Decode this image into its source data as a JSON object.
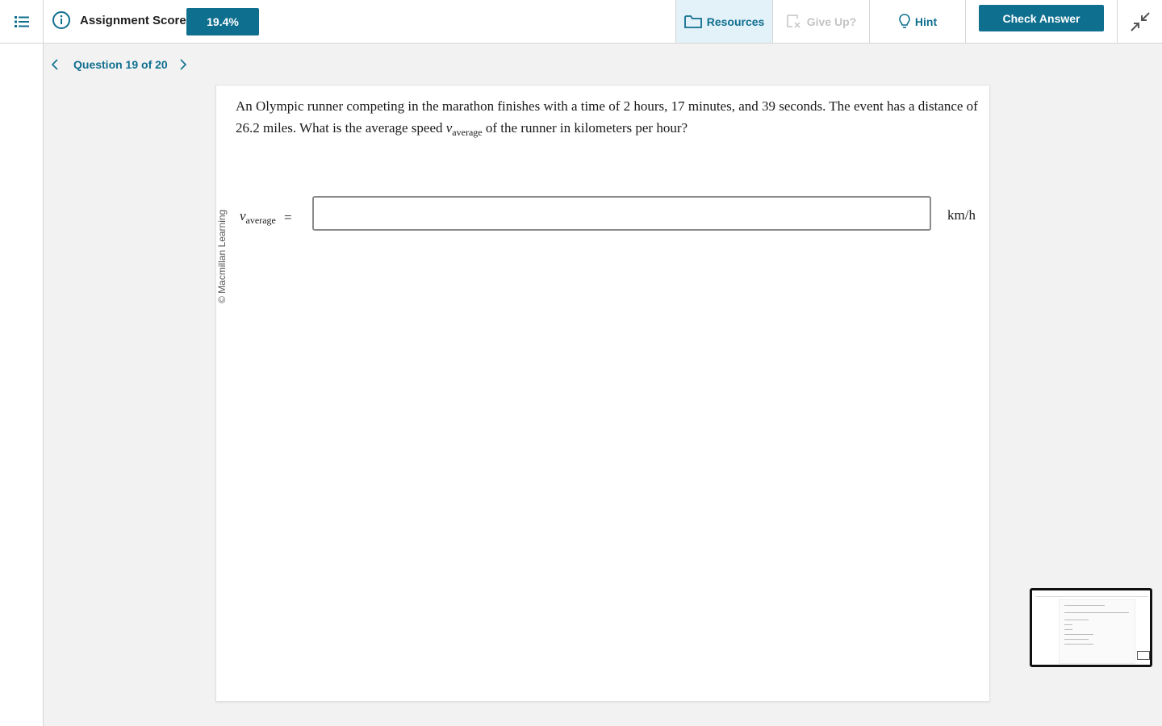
{
  "topbar": {
    "score_label": "Assignment Score:",
    "score_value": "19.4%",
    "resources_label": "Resources",
    "giveup_label": "Give Up?",
    "hint_label": "Hint",
    "check_label": "Check Answer"
  },
  "nav": {
    "question_label": "Question 19 of 20"
  },
  "question": {
    "copyright": "© Macmillan Learning",
    "text_part1": "An Olympic runner competing in the marathon finishes with a time of 2 hours, 17 minutes, and 39 seconds. The event has a distance of 26.2 miles. What is the average speed ",
    "var_symbol": "v",
    "var_subscript": "average",
    "text_part2": " of the runner in kilometers per hour?",
    "answer_equals": "=",
    "answer_value": "",
    "answer_unit": "km/h"
  },
  "colors": {
    "accent": "#0f6f8f",
    "resources_bg": "#e3f1f8",
    "disabled": "#c4c4c4"
  }
}
